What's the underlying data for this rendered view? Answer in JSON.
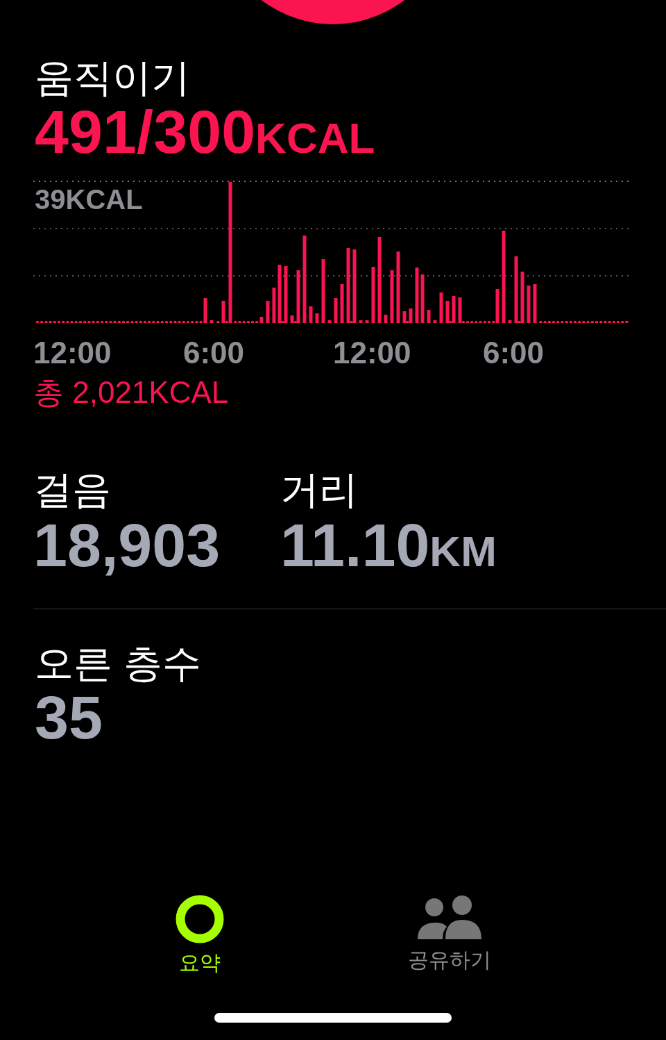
{
  "move": {
    "title": "움직이기",
    "value": "491/300",
    "unit": "KCAL"
  },
  "chart": {
    "max_label": "39KCAL",
    "x_labels": [
      "12:00",
      "6:00",
      "12:00",
      "6:00"
    ],
    "total": "총 2,021KCAL"
  },
  "stats": [
    {
      "title": "걸음",
      "value": "18,903"
    },
    {
      "title": "거리",
      "value": "11.10",
      "unit": "KM"
    }
  ],
  "floors": {
    "title": "오른 층수",
    "value": "35"
  },
  "tabs": [
    {
      "label": "요약",
      "selected": true,
      "kind": "ring"
    },
    {
      "label": "공유하기",
      "selected": false,
      "kind": "people"
    }
  ]
}
